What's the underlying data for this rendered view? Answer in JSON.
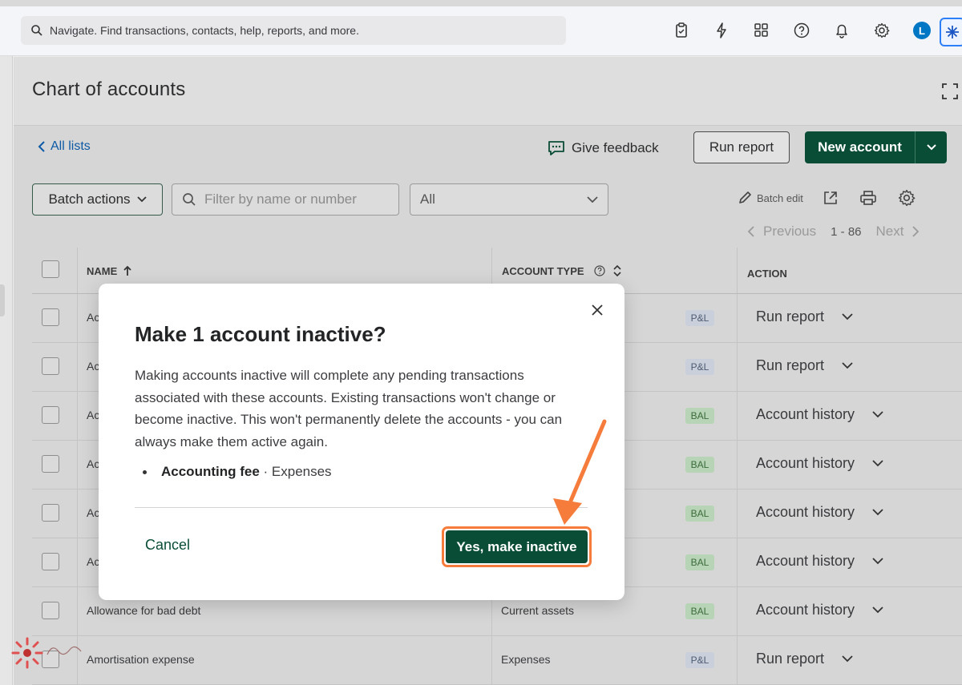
{
  "topbar": {
    "search_placeholder": "Navigate. Find transactions, contacts, help, reports, and more.",
    "icons": [
      "clipboard-icon",
      "lightning-icon",
      "apps-icon",
      "help-icon",
      "bell-icon",
      "gear-icon"
    ],
    "avatar_letter": "L"
  },
  "page": {
    "title": "Chart of accounts",
    "all_lists": "All lists",
    "give_feedback": "Give feedback",
    "run_report": "Run report",
    "new_account": "New account",
    "batch_actions": "Batch actions",
    "filter_placeholder": "Filter by name or number",
    "type_filter": "All",
    "batch_edit": "Batch edit",
    "pager": {
      "previous": "Previous",
      "range": "1 - 86",
      "next": "Next"
    }
  },
  "table": {
    "headers": {
      "name": "NAME",
      "account_type": "ACCOUNT TYPE",
      "action": "ACTION"
    },
    "rows": [
      {
        "name": "Ac",
        "type": "",
        "badge": "P&L",
        "action": "Run report"
      },
      {
        "name": "Ac",
        "type": "",
        "badge": "P&L",
        "action": "Run report"
      },
      {
        "name": "Ac",
        "type": "",
        "badge": "BAL",
        "action": "Account history"
      },
      {
        "name": "Ac",
        "type": "",
        "badge": "BAL",
        "action": "Account history"
      },
      {
        "name": "Ac",
        "type": "",
        "badge": "BAL",
        "action": "Account history"
      },
      {
        "name": "Ac",
        "type": "",
        "badge": "BAL",
        "action": "Account history"
      },
      {
        "name": "Allowance for bad debt",
        "type": "Current assets",
        "badge": "BAL",
        "action": "Account history"
      },
      {
        "name": "Amortisation expense",
        "type": "Expenses",
        "badge": "P&L",
        "action": "Run report"
      }
    ]
  },
  "modal": {
    "title": "Make 1 account inactive?",
    "body": "Making accounts inactive will complete any pending transactions associated with these accounts. Existing transactions won't change or become inactive. This won't permanently delete the accounts - you can always make them active again.",
    "item_name": "Accounting fee",
    "item_detail": " · Expenses",
    "cancel": "Cancel",
    "confirm": "Yes, make inactive"
  },
  "colors": {
    "brand_green": "#0a4d37",
    "highlight_orange": "#f57c3b",
    "link_blue": "#0d5aa7"
  }
}
